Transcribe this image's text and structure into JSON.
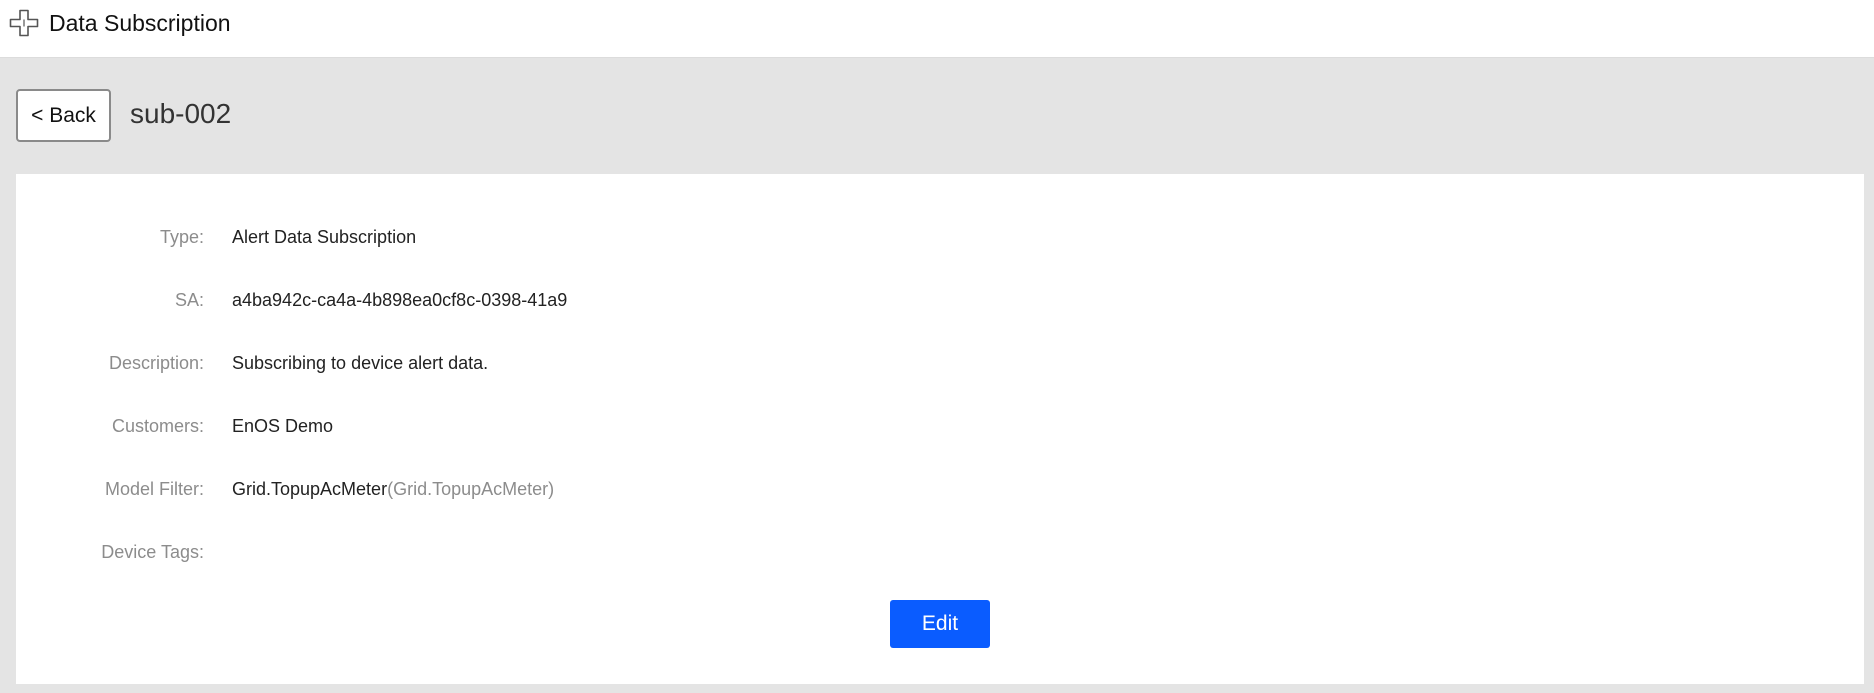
{
  "app": {
    "title": "Data Subscription",
    "logo_icon": "cross-logo-icon"
  },
  "subheader": {
    "back_label": "< Back",
    "title": "sub-002"
  },
  "details": {
    "fields": [
      {
        "label": "Type:",
        "value": "Alert Data Subscription"
      },
      {
        "label": "SA:",
        "value": "a4ba942c-ca4a-4b898ea0cf8c-0398-41a9"
      },
      {
        "label": "Description:",
        "value": "Subscribing to device alert data."
      },
      {
        "label": "Customers:",
        "value": "EnOS Demo"
      },
      {
        "label": "Model Filter:",
        "value": "Grid.TopupAcMeter",
        "value_secondary": "(Grid.TopupAcMeter)"
      },
      {
        "label": "Device Tags:",
        "value": ""
      }
    ],
    "edit_label": "Edit"
  },
  "colors": {
    "primary": "#0a5cff",
    "page_background": "#e4e4e4",
    "label_gray": "#8c8c8c"
  }
}
